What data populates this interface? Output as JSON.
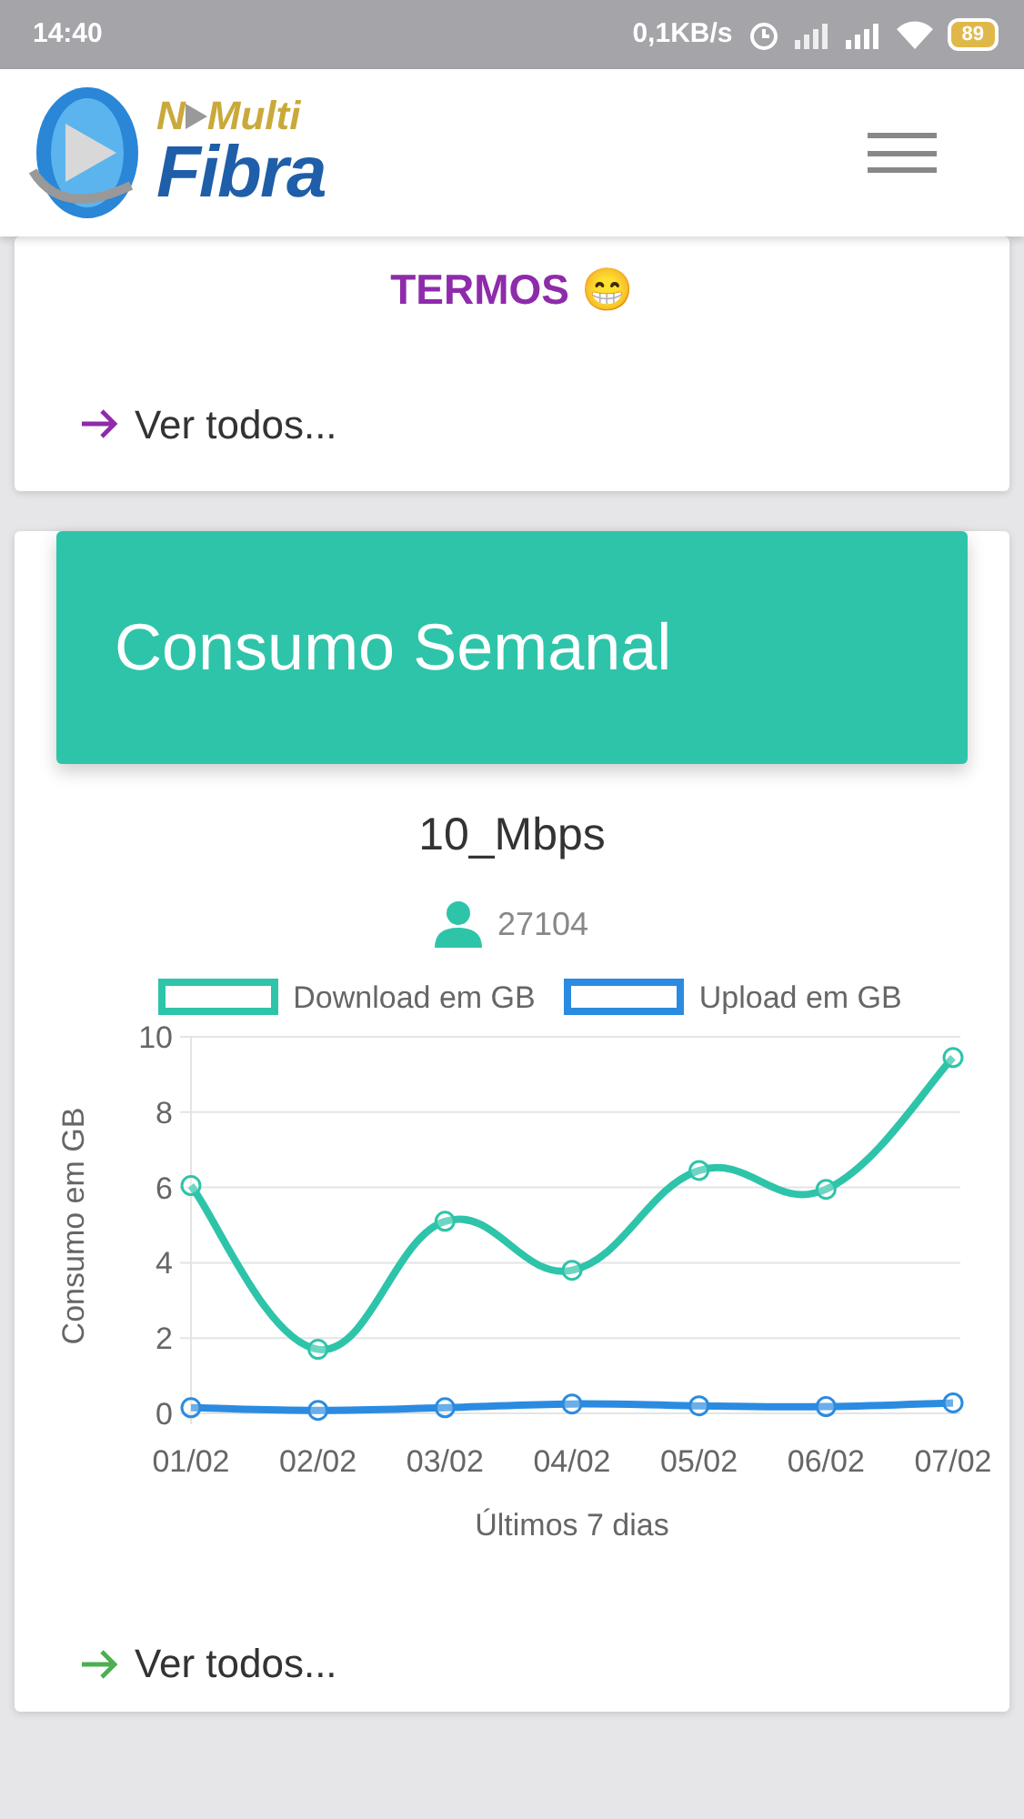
{
  "status_bar": {
    "time": "14:40",
    "speed": "0,1KB/s",
    "battery": "89"
  },
  "header": {
    "logo": {
      "top_a": "N",
      "top_b": "Multi",
      "bottom": "Fibra"
    }
  },
  "notice_card": {
    "message": "TERMOS 😁",
    "link": "Ver todos..."
  },
  "consumption_card": {
    "title": "Consumo Semanal",
    "plan": "10_Mbps",
    "client_id": "27104",
    "chart_data": {
      "type": "line",
      "xlabel": "Últimos 7 dias",
      "ylabel": "Consumo em GB",
      "categories": [
        "01/02",
        "02/02",
        "03/02",
        "04/02",
        "05/02",
        "06/02",
        "07/02"
      ],
      "series": [
        {
          "name": "Download em GB",
          "color": "#2ec4a9",
          "marker": "circle",
          "values": [
            6.05,
            1.7,
            5.1,
            3.8,
            6.45,
            5.95,
            9.45
          ]
        },
        {
          "name": "Upload em GB",
          "color": "#2b8be0",
          "marker": "circle",
          "values": [
            0.15,
            0.08,
            0.15,
            0.25,
            0.2,
            0.18,
            0.28
          ]
        }
      ],
      "ylim": [
        0,
        10
      ],
      "yticks": [
        0,
        2,
        4,
        6,
        8,
        10
      ],
      "grid": true,
      "legend": true
    },
    "link": "Ver todos..."
  }
}
